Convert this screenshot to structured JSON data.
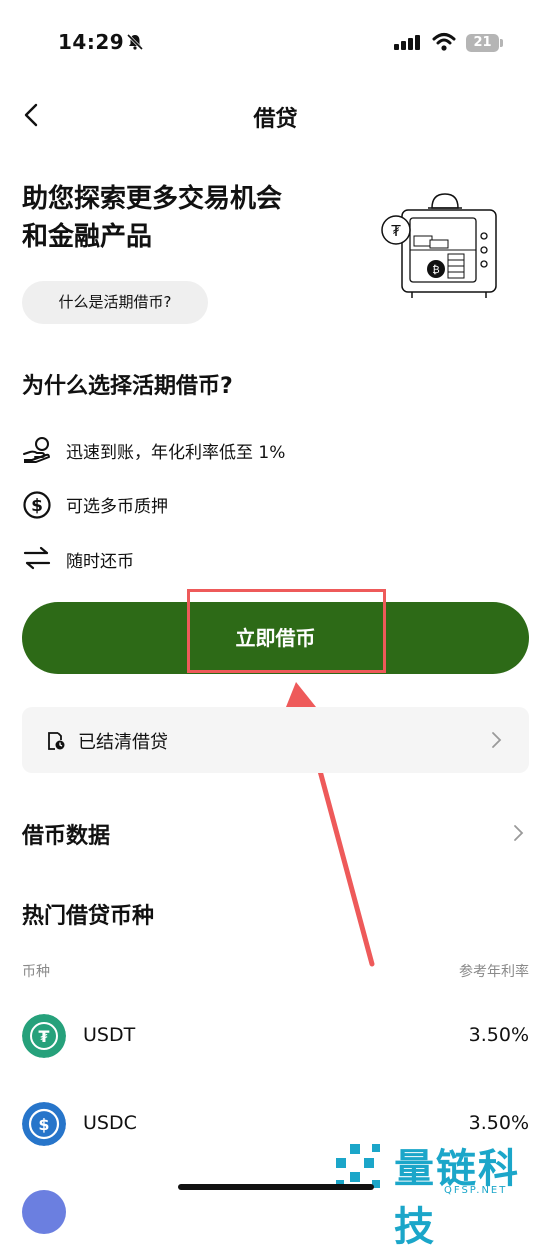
{
  "status_bar": {
    "time": "14:29",
    "battery": "21"
  },
  "nav": {
    "title": "借贷"
  },
  "hero": {
    "title_line1": "助您探索更多交易机会",
    "title_line2": "和金融产品",
    "what_button": "什么是活期借币?"
  },
  "why": {
    "title": "为什么选择活期借币?",
    "features": [
      {
        "icon": "hand-coin-icon",
        "text": "迅速到账，年化利率低至 1%"
      },
      {
        "icon": "dollar-circle-icon",
        "text": "可选多币质押"
      },
      {
        "icon": "swap-arrows-icon",
        "text": "随时还币"
      }
    ]
  },
  "cta": {
    "label": "立即借币"
  },
  "settled": {
    "label": "已结清借贷"
  },
  "loan_data": {
    "title": "借币数据"
  },
  "popular": {
    "title": "热门借贷币种",
    "col_coin": "币种",
    "col_rate": "参考年利率",
    "coins": [
      {
        "name": "USDT",
        "rate": "3.50%",
        "color": "#26a17b"
      },
      {
        "name": "USDC",
        "rate": "3.50%",
        "color": "#2775ca"
      }
    ]
  },
  "watermark": {
    "text": "量链科技",
    "sub": "QFSP.NET"
  },
  "colors": {
    "accent": "#2d6a17",
    "highlight": "#ee5a5a"
  }
}
